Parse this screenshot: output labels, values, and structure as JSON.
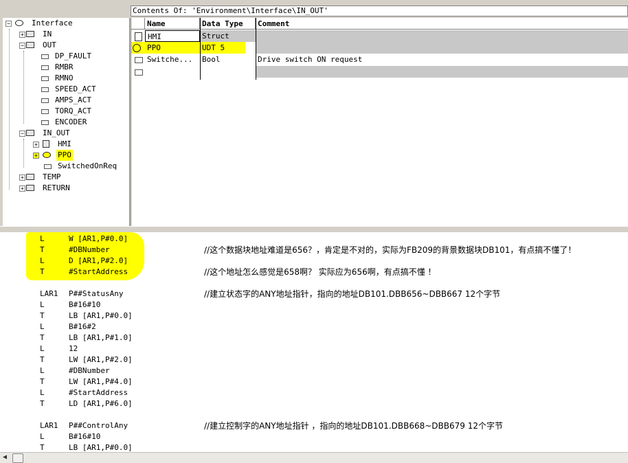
{
  "header": {
    "contents_label": "Contents Of: 'Environment\\Interface\\IN_OUT'"
  },
  "tree": {
    "root": "Interface",
    "in": "IN",
    "out": "OUT",
    "out_items": [
      "DP_FAULT",
      "RMBR",
      "RMNO",
      "SPEED_ACT",
      "AMPS_ACT",
      "TORQ_ACT",
      "ENCODER"
    ],
    "in_out": "IN_OUT",
    "in_out_items": [
      "HMI",
      "PPO",
      "SwitchedOnReq"
    ],
    "temp": "TEMP",
    "return": "RETURN"
  },
  "table": {
    "columns": [
      "Name",
      "Data Type",
      "Comment"
    ],
    "rows": [
      {
        "name": "HMI",
        "type": "Struct",
        "comment": ""
      },
      {
        "name": "PPO",
        "type": "UDT 5",
        "comment": ""
      },
      {
        "name": "Switche...",
        "type": "Bool",
        "comment": "Drive switch ON request"
      }
    ]
  },
  "code": [
    {
      "op": "L",
      "arg": "W [AR1,P#0.0]",
      "comment": ""
    },
    {
      "op": "T",
      "arg": "#DBNumber",
      "comment": "//这个数据块地址难道是656？，肯定是不对的，实际为FB209的背景数据块DB101，有点搞不懂了！"
    },
    {
      "op": "L",
      "arg": "D [AR1,P#2.0]",
      "comment": ""
    },
    {
      "op": "T",
      "arg": "#StartAddress",
      "comment": "//这个地址怎么感觉是658啊？ 实际应为656啊，有点搞不懂 ！"
    },
    {
      "op": "",
      "arg": "",
      "comment": ""
    },
    {
      "op": "LAR1",
      "arg": "P##StatusAny",
      "comment": "//建立状态字的ANY地址指针，指向的地址DB101.DBB656~DBB667 12个字节"
    },
    {
      "op": "L",
      "arg": "B#16#10",
      "comment": ""
    },
    {
      "op": "T",
      "arg": "LB [AR1,P#0.0]",
      "comment": ""
    },
    {
      "op": "L",
      "arg": "B#16#2",
      "comment": ""
    },
    {
      "op": "T",
      "arg": "LB [AR1,P#1.0]",
      "comment": ""
    },
    {
      "op": "L",
      "arg": "12",
      "comment": ""
    },
    {
      "op": "T",
      "arg": "LW [AR1,P#2.0]",
      "comment": ""
    },
    {
      "op": "L",
      "arg": "#DBNumber",
      "comment": ""
    },
    {
      "op": "T",
      "arg": "LW [AR1,P#4.0]",
      "comment": ""
    },
    {
      "op": "L",
      "arg": "#StartAddress",
      "comment": ""
    },
    {
      "op": "T",
      "arg": "LD [AR1,P#6.0]",
      "comment": ""
    },
    {
      "op": "",
      "arg": "",
      "comment": ""
    },
    {
      "op": "LAR1",
      "arg": "P##ControlAny",
      "comment": "//建立控制字的ANY地址指针 ，指向的地址DB101.DBB668~DBB679 12个字节"
    },
    {
      "op": "L",
      "arg": "B#16#10",
      "comment": ""
    },
    {
      "op": "T",
      "arg": "LB [AR1,P#0.0]",
      "comment": ""
    }
  ],
  "colors": {
    "highlight": "#ffff00",
    "grey_row": "#c8c8c8"
  }
}
